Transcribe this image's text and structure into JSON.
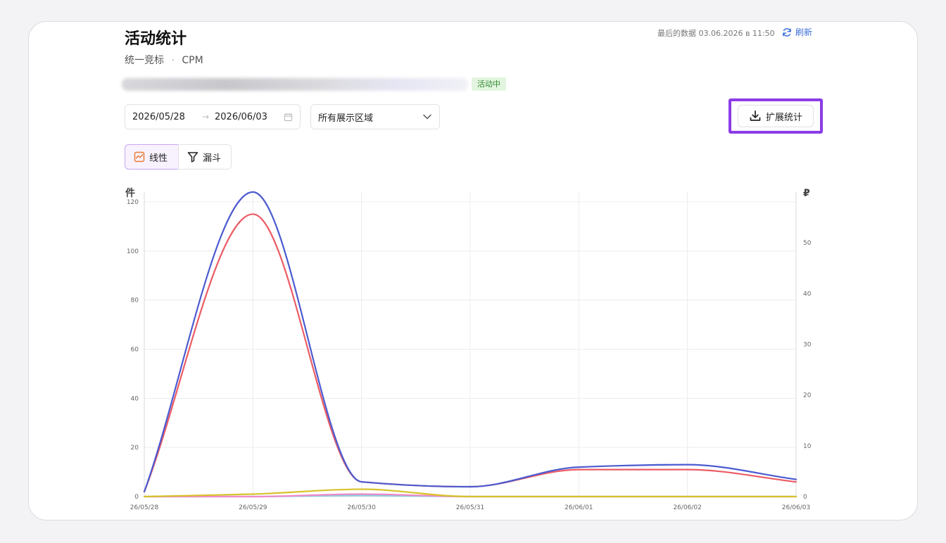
{
  "header": {
    "title": "活动统计",
    "subtitle_type": "统一竞标",
    "subtitle_dot": "·",
    "subtitle_model": "CPM",
    "status_badge": "活动中",
    "last_data": "最后的数据 03.06.2026 в 11:50",
    "refresh_label": "刷新"
  },
  "filters": {
    "date_start": "2026/05/28",
    "date_arrow": "→",
    "date_end": "2026/06/03",
    "zone_select": "所有展示区域",
    "export_label": "扩展统计"
  },
  "view_toggle": {
    "line_label": "线性",
    "funnel_label": "漏斗"
  },
  "colors": {
    "accent": "#8b3ce6",
    "blue": "#4b5bd0",
    "red": "#ec5b64",
    "yellow": "#d8c22a",
    "pink": "#f08ac8",
    "cyan": "#7fd0e0",
    "badge_bg": "#e3f5e0",
    "badge_text": "#2f8a2f",
    "link": "#3b6fd8"
  },
  "icons": {
    "refresh": "refresh-icon",
    "calendar": "calendar-icon",
    "chevron": "chevron-down-icon",
    "download": "download-icon",
    "line_chart": "line-chart-icon",
    "funnel": "funnel-icon"
  },
  "chart_data": {
    "type": "line",
    "x": [
      "26/05/28",
      "26/05/29",
      "26/05/30",
      "26/05/31",
      "26/06/01",
      "26/06/02",
      "26/06/03"
    ],
    "y_left_label": "件",
    "y_right_label": "₽",
    "y_left_ticks": [
      0,
      20,
      40,
      60,
      80,
      100,
      120
    ],
    "y_right_ticks": [
      0,
      10,
      20,
      30,
      40,
      50
    ],
    "ylim_left": [
      0,
      124
    ],
    "ylim_right": [
      0,
      60
    ],
    "grid": true,
    "series": [
      {
        "axis": "left",
        "color": "#4b5bd0",
        "values": [
          2,
          124,
          6,
          4,
          12,
          13,
          7
        ]
      },
      {
        "axis": "left",
        "color": "#ec5b64",
        "values": [
          2,
          115,
          6,
          4,
          11,
          11,
          6
        ]
      },
      {
        "axis": "left",
        "color": "#d8c22a",
        "values": [
          0,
          1,
          3,
          0,
          0,
          0,
          0
        ]
      },
      {
        "axis": "left",
        "color": "#f08ac8",
        "values": [
          0,
          0,
          1,
          0,
          0,
          0,
          0
        ]
      },
      {
        "axis": "left",
        "color": "#7fd0e0",
        "values": [
          0,
          0,
          0.5,
          0,
          0,
          0,
          0
        ]
      }
    ]
  }
}
